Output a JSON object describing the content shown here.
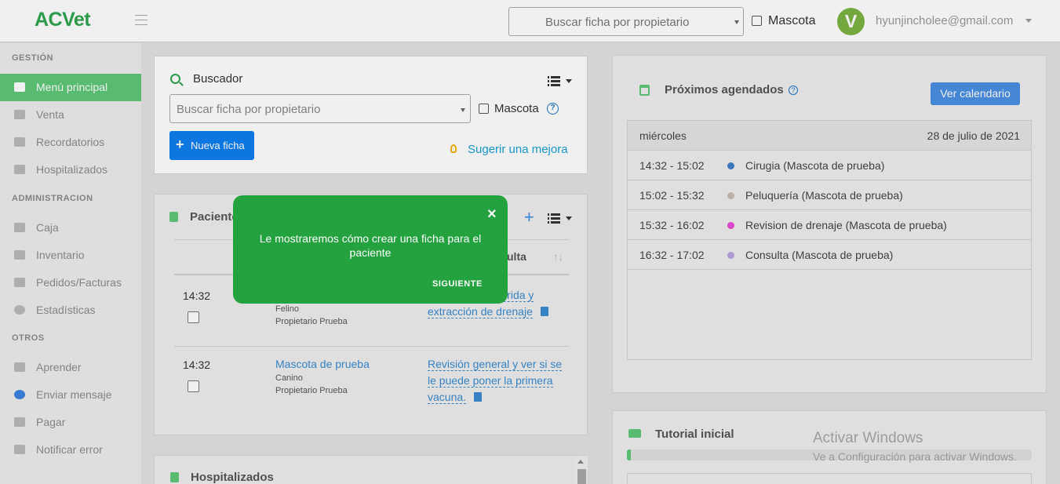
{
  "header": {
    "logo": "ACVet",
    "search_placeholder": "Buscar ficha por propietario",
    "mascota_label": "Mascota",
    "avatar_letter": "V",
    "user_email": "hyunjincholee@gmail.com"
  },
  "sidebar": {
    "sections": [
      {
        "title": "GESTIÓN",
        "items": [
          {
            "label": "Menú principal",
            "active": true
          },
          {
            "label": "Venta"
          },
          {
            "label": "Recordatorios"
          },
          {
            "label": "Hospitalizados"
          }
        ]
      },
      {
        "title": "ADMINISTRACION",
        "items": [
          {
            "label": "Caja"
          },
          {
            "label": "Inventario"
          },
          {
            "label": "Pedidos/Facturas"
          },
          {
            "label": "Estadísticas"
          }
        ]
      },
      {
        "title": "OTROS",
        "items": [
          {
            "label": "Aprender"
          },
          {
            "label": "Enviar mensaje"
          },
          {
            "label": "Pagar"
          },
          {
            "label": "Notificar error"
          }
        ]
      }
    ]
  },
  "buscador": {
    "title": "Buscador",
    "search_placeholder": "Buscar ficha por propietario",
    "mascota_label": "Mascota",
    "help_glyph": "?",
    "new_button": "Nueva ficha",
    "suggest_link": "Sugerir una mejora"
  },
  "pacientes": {
    "title": "Pacientes",
    "col_consulta": "ulta",
    "sort_glyph": "↑↓",
    "rows": [
      {
        "time": "14:32",
        "pet": "",
        "species": "Felino",
        "owner": "Propietario Prueba",
        "consulta": "l. limpieza de herida y extracción de drenaje"
      },
      {
        "time": "14:32",
        "pet": "Mascota de prueba",
        "species": "Canino",
        "owner": "Propietario Prueba",
        "consulta": "Revisión general y ver si se le puede poner la primera vacuna."
      }
    ]
  },
  "hospitalizados": {
    "title": "Hospitalizados"
  },
  "tooltip": {
    "close": "×",
    "message": "Le mostraremos cómo crear una ficha para el paciente",
    "next": "SIGUIENTE"
  },
  "agenda": {
    "title": "Próximos agendados",
    "help_glyph": "?",
    "calendar_button": "Ver calendario",
    "day": "miércoles",
    "date": "28 de julio de 2021",
    "items": [
      {
        "time": "14:32 - 15:02",
        "desc": "Cirugia (Mascota de prueba)",
        "color": "#3e7fc9"
      },
      {
        "time": "15:02 - 15:32",
        "desc": "Peluquería (Mascota de prueba)",
        "color": "#c9bcb0"
      },
      {
        "time": "15:32 - 16:02",
        "desc": "Revision de drenaje (Mascota de prueba)",
        "color": "#e84bd6"
      },
      {
        "time": "16:32 - 17:02",
        "desc": "Consulta (Mascota de prueba)",
        "color": "#b9a4e0"
      }
    ]
  },
  "tutorial": {
    "title": "Tutorial inicial",
    "progress": 0.01
  },
  "windows_watermark": {
    "line1": "Activar Windows",
    "line2": "Ve a Configuración para activar Windows."
  }
}
